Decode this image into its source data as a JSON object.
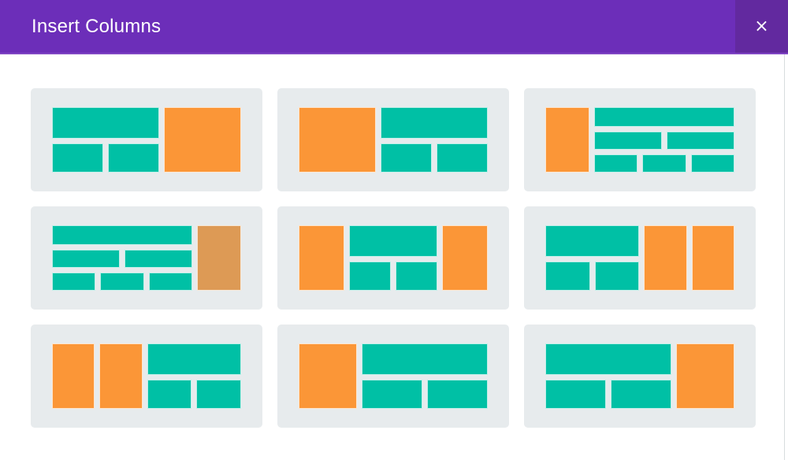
{
  "window": {
    "title": "Insert Columns"
  },
  "header": {
    "title": "Insert Columns",
    "close_label": "×",
    "background_color": "#6c2eb9",
    "close_background_color": "#62299f",
    "title_color": "#ffffff"
  },
  "palette": {
    "teal": "#00c0a5",
    "orange": "#fb9637",
    "orange_hover": "#dd9a55",
    "card_background": "#e7ebed",
    "page_background": "#ffffff"
  },
  "layouts": {
    "count": 9,
    "items": [
      {
        "id": "layout-1",
        "name": "two-thirds-stacked-left-one-third-right",
        "hovered": false
      },
      {
        "id": "layout-2",
        "name": "one-third-left-two-thirds-stacked-right",
        "hovered": false
      },
      {
        "id": "layout-3",
        "name": "narrow-left-column-three-row-stack-right",
        "hovered": false
      },
      {
        "id": "layout-4",
        "name": "three-row-stack-left-narrow-right-column",
        "hovered": true
      },
      {
        "id": "layout-5",
        "name": "column-stack-column",
        "hovered": false
      },
      {
        "id": "layout-6",
        "name": "stack-left-two-columns-right",
        "hovered": false
      },
      {
        "id": "layout-7",
        "name": "two-columns-left-stack-right",
        "hovered": false
      },
      {
        "id": "layout-8",
        "name": "block-left-stack-right",
        "hovered": false
      },
      {
        "id": "layout-9",
        "name": "stack-left-block-right",
        "hovered": false
      }
    ]
  }
}
